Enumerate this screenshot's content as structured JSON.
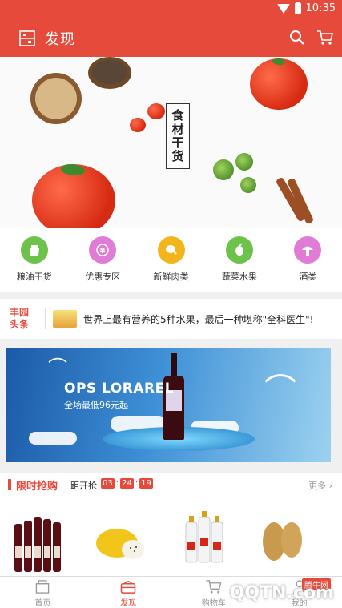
{
  "status_bar": {
    "time": "10:35"
  },
  "header": {
    "title": "发现"
  },
  "banner": {
    "title_text": "食材干货"
  },
  "categories": [
    {
      "label": "粮油干货",
      "icon": "grain-bag-icon",
      "color": "#6cc24a"
    },
    {
      "label": "优惠专区",
      "icon": "coupon-icon",
      "color": "#e07bd6"
    },
    {
      "label": "新鲜肉类",
      "icon": "meat-icon",
      "color": "#f2b51c"
    },
    {
      "label": "蔬菜水果",
      "icon": "vegetable-icon",
      "color": "#6cc24a"
    },
    {
      "label": "酒类",
      "icon": "mushroom-icon",
      "color": "#e07bd6"
    }
  ],
  "headline": {
    "tag_line1": "丰园",
    "tag_line2": "头条",
    "text": "世界上最有营养的5种水果，最后一种堪称\"全科医生\"!"
  },
  "ad": {
    "brand": "OPS LORAREL",
    "subtitle": "全场最低96元起"
  },
  "flash_sale": {
    "title": "限时抢购",
    "countdown_label": "距开抢",
    "hours": "03",
    "minutes": "24",
    "seconds": "19",
    "more_label": "更多"
  },
  "tabs": [
    {
      "label": "首页",
      "icon": "home-icon"
    },
    {
      "label": "发现",
      "icon": "discover-icon"
    },
    {
      "label": "购物车",
      "icon": "cart-icon"
    },
    {
      "label": "我的",
      "icon": "profile-icon"
    }
  ],
  "watermark": {
    "text": "QQTN.com",
    "badge": "腾牛网"
  },
  "colors": {
    "accent": "#e64a3b"
  }
}
